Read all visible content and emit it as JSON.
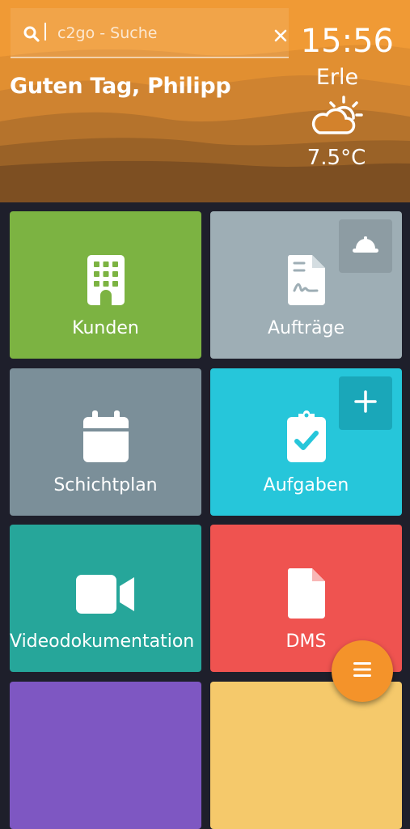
{
  "search": {
    "placeholder": "c2go - Suche",
    "value": ""
  },
  "header": {
    "greeting": "Guten Tag, Philipp",
    "time": "15:56",
    "location": "Erle",
    "weather_icon": "partly-cloudy-icon",
    "temperature": "7.5°C"
  },
  "tiles": [
    {
      "label": "Kunden",
      "icon": "building-icon",
      "color": "#7cb342"
    },
    {
      "label": "Aufträge",
      "icon": "document-signature-icon",
      "color": "#9eaeb5",
      "corner_icon": "hard-hat-icon"
    },
    {
      "label": "Schichtplan",
      "icon": "calendar-icon",
      "color": "#7b8f99"
    },
    {
      "label": "Aufgaben",
      "icon": "clipboard-check-icon",
      "color": "#26c6da",
      "corner_icon": "plus-icon"
    },
    {
      "label": "Videodokumentation",
      "icon": "video-camera-icon",
      "color": "#26a69a"
    },
    {
      "label": "DMS",
      "icon": "file-icon",
      "color": "#ef5350"
    },
    {
      "label": "",
      "color": "#7e57c2"
    },
    {
      "label": "",
      "color": "#f5c96b"
    }
  ],
  "fab": {
    "icon": "menu-icon",
    "color": "#f4932a"
  },
  "colors": {
    "header": "#d3822c",
    "background": "#1e1f2b"
  }
}
